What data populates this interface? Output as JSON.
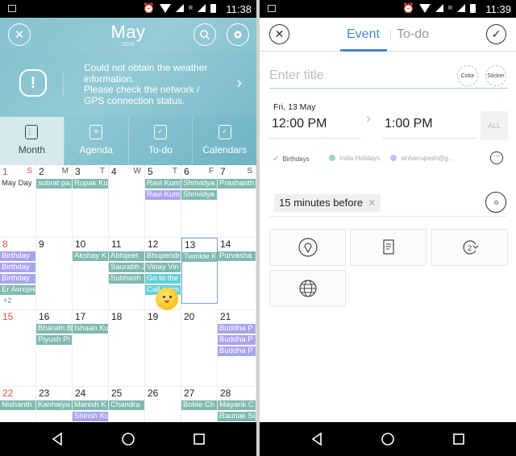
{
  "left": {
    "status": {
      "time": "11:38",
      "roaming": "R",
      "battery": "90"
    },
    "header": {
      "month": "May",
      "year": "2016",
      "close_icon": "close-icon",
      "search_icon": "search-icon",
      "settings_icon": "gear-icon"
    },
    "weather": {
      "message": "Could not obtain the weather information.\nPlease check the network / GPS connection status.",
      "icon": "alert-icon",
      "chevron": "chevron-right-icon"
    },
    "tabs": [
      {
        "label": "Month",
        "icon": "calendar-grid-icon",
        "selected": true
      },
      {
        "label": "Agenda",
        "icon": "agenda-icon",
        "selected": false
      },
      {
        "label": "To-do",
        "icon": "todo-check-icon",
        "selected": false
      },
      {
        "label": "Calendars",
        "icon": "calendars-icon",
        "selected": false
      }
    ],
    "weekday_labels": [
      "S",
      "M",
      "T",
      "W",
      "T",
      "F",
      "S"
    ],
    "weeks": [
      [
        {
          "day": "1",
          "sunday": true,
          "events": [
            {
              "t": "May Day",
              "c": "plain"
            }
          ]
        },
        {
          "day": "2",
          "events": [
            {
              "t": "subrat pa",
              "c": "teal"
            }
          ]
        },
        {
          "day": "3",
          "events": [
            {
              "t": "Rupak Ku",
              "c": "teal"
            }
          ]
        },
        {
          "day": "4",
          "events": []
        },
        {
          "day": "5",
          "events": [
            {
              "t": "Ravi Kum",
              "c": "teal"
            },
            {
              "t": "Ravi Kum",
              "c": "purple"
            }
          ]
        },
        {
          "day": "6",
          "events": [
            {
              "t": "Shrividya",
              "c": "teal"
            },
            {
              "t": "Shrividya",
              "c": "teal"
            }
          ]
        },
        {
          "day": "7",
          "events": [
            {
              "t": "Prashanth",
              "c": "teal"
            }
          ]
        }
      ],
      [
        {
          "day": "8",
          "sunday": true,
          "events": [
            {
              "t": "Birthday",
              "c": "purple"
            },
            {
              "t": "Birthday",
              "c": "purple"
            },
            {
              "t": "Birthday",
              "c": "purple"
            },
            {
              "t": "Er Avrojee",
              "c": "teal"
            }
          ],
          "more": "+2"
        },
        {
          "day": "9",
          "events": []
        },
        {
          "day": "10",
          "events": [
            {
              "t": "Akshay K",
              "c": "teal"
            }
          ]
        },
        {
          "day": "11",
          "events": [
            {
              "t": "Abhijeet",
              "c": "teal"
            },
            {
              "t": "Saurabh J",
              "c": "teal"
            },
            {
              "t": "Subhash",
              "c": "teal"
            }
          ]
        },
        {
          "day": "12",
          "events": [
            {
              "t": "Bhupendr",
              "c": "teal"
            },
            {
              "t": "Vinay Vin",
              "c": "teal"
            },
            {
              "t": "Go to the",
              "c": "cyan"
            },
            {
              "t": "Call mom",
              "c": "cyan"
            }
          ]
        },
        {
          "day": "13",
          "today": true,
          "events": [
            {
              "t": "Twinkle K",
              "c": "teal"
            }
          ]
        },
        {
          "day": "14",
          "events": [
            {
              "t": "Purvasha",
              "c": "teal"
            }
          ]
        }
      ],
      [
        {
          "day": "15",
          "sunday": true,
          "events": []
        },
        {
          "day": "16",
          "events": [
            {
              "t": "Bharath B",
              "c": "teal"
            },
            {
              "t": "Piyush Pi",
              "c": "teal"
            }
          ]
        },
        {
          "day": "17",
          "events": [
            {
              "t": "Ishaan Ku",
              "c": "teal"
            }
          ]
        },
        {
          "day": "18",
          "events": []
        },
        {
          "day": "19",
          "events": []
        },
        {
          "day": "20",
          "events": []
        },
        {
          "day": "21",
          "events": [
            {
              "t": "Buddha P",
              "c": "purple"
            },
            {
              "t": "Buddha P",
              "c": "purple"
            },
            {
              "t": "Buddha P",
              "c": "purple"
            }
          ]
        }
      ],
      [
        {
          "day": "22",
          "sunday": true,
          "events": [
            {
              "t": "Nishanth",
              "c": "teal"
            }
          ]
        },
        {
          "day": "23",
          "events": [
            {
              "t": "Kanhaiya",
              "c": "teal"
            }
          ]
        },
        {
          "day": "24",
          "events": [
            {
              "t": "Manish K",
              "c": "teal"
            },
            {
              "t": "Shirish Ku",
              "c": "purple"
            }
          ]
        },
        {
          "day": "25",
          "events": [
            {
              "t": "Chandra",
              "c": "teal"
            }
          ]
        },
        {
          "day": "26",
          "events": []
        },
        {
          "day": "27",
          "events": [
            {
              "t": "Bobie Ch",
              "c": "teal"
            }
          ]
        },
        {
          "day": "28",
          "events": [
            {
              "t": "Mayank C",
              "c": "teal"
            },
            {
              "t": "Raunak Su",
              "c": "teal"
            }
          ]
        }
      ]
    ]
  },
  "right": {
    "status": {
      "time": "11:39",
      "roaming": "R",
      "battery": "90"
    },
    "header": {
      "tab_event": "Event",
      "tab_todo": "To-do",
      "close_icon": "close-icon",
      "confirm_icon": "check-icon"
    },
    "title": {
      "placeholder": "Enter title",
      "value": ""
    },
    "color_label": "Color",
    "sticker_label": "Sticker",
    "date": "Fri, 13 May",
    "start_time": "12:00 PM",
    "end_time": "1:00 PM",
    "all_day_label": "ALL",
    "calendars": [
      {
        "label": "Birthdays",
        "selected": true,
        "color": "#7fbab0"
      },
      {
        "label": "India Holidays",
        "selected": false,
        "color": "#a6d2cb"
      },
      {
        "label": "sinharrupesh@g...",
        "selected": false,
        "color": "#c2c2f2"
      }
    ],
    "more_icon": "more-icon",
    "reminder": "15 minutes before",
    "options": [
      {
        "icon": "location-pin-icon"
      },
      {
        "icon": "memo-icon"
      },
      {
        "icon": "repeat-icon"
      },
      {
        "icon": "globe-icon"
      }
    ]
  },
  "colors": {
    "hero": "#7cbccc",
    "teal_event": "#7fbab0",
    "purple_event": "#a9a4ee",
    "cyan_event": "#63cfd8",
    "accent_blue": "#4a86d0",
    "sunday_red": "#e05050"
  }
}
